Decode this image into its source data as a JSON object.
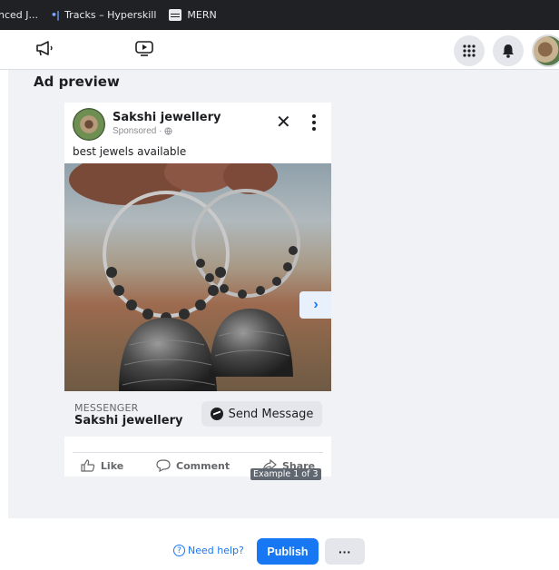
{
  "bookmarks": [
    {
      "label": "nced J...",
      "icon": "bookmark-icon"
    },
    {
      "label": "Tracks – Hyperskill",
      "icon": "hyperskill-icon"
    },
    {
      "label": "MERN",
      "icon": "folder-icon"
    }
  ],
  "nav": {
    "icons": [
      "megaphone-icon",
      "video-icon",
      "apps-grid-icon",
      "bell-icon",
      "profile-avatar"
    ]
  },
  "preview": {
    "title": "Ad preview",
    "page_name": "Sakshi jewellery",
    "sponsored": "Sponsored · ",
    "caption": "best jewels available",
    "cta_label": "MESSENGER",
    "cta_name": "Sakshi jewellery",
    "cta_button": "Send Message",
    "actions": {
      "like": "Like",
      "comment": "Comment",
      "share": "Share"
    },
    "example_badge": "Example 1 of 3"
  },
  "footer": {
    "help": "Need help?",
    "publish": "Publish",
    "more": "···"
  },
  "colors": {
    "accent": "#1877f2",
    "panel_bg": "#f0f2f5",
    "bookmark_bar": "#202124"
  }
}
